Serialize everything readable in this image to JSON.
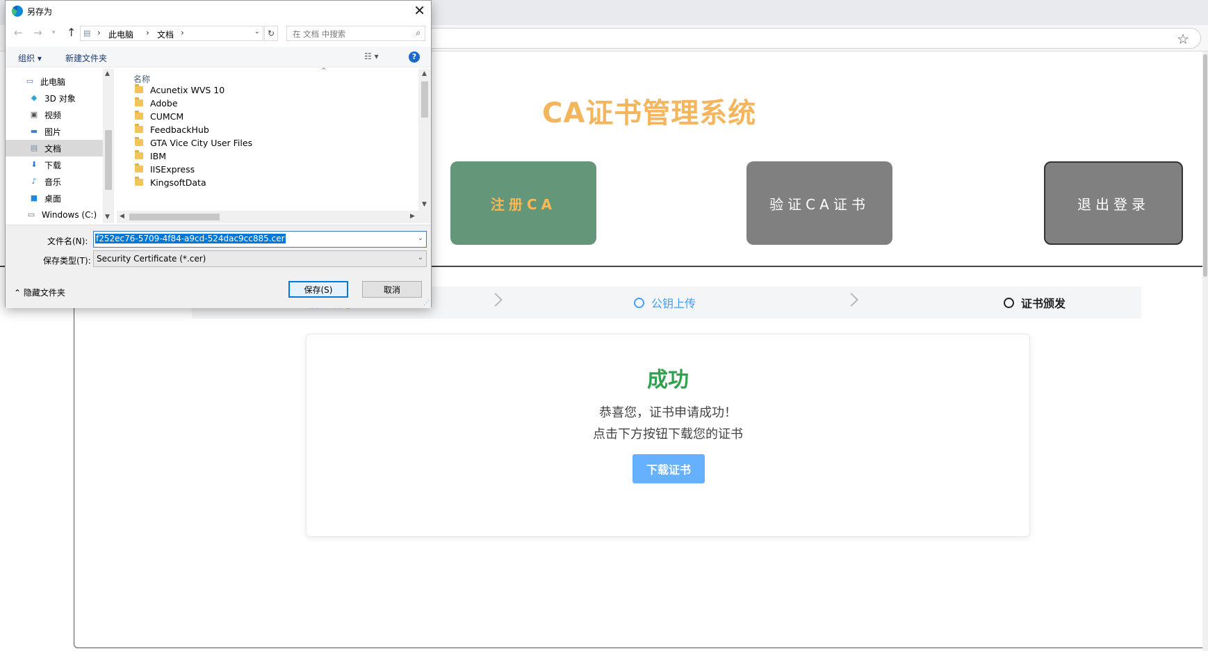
{
  "page": {
    "title": "CA证书管理系统",
    "nav_buttons": {
      "register": "注册CA",
      "verify": "验证CA证书",
      "logout": "退出登录"
    },
    "steps": [
      {
        "label": "CSR信息填写"
      },
      {
        "label": "公钥上传"
      },
      {
        "label": "证书颁发"
      }
    ],
    "result": {
      "title": "成功",
      "line1": "恭喜您，证书申请成功！",
      "line2": "点击下方按钮下载您的证书",
      "download_label": "下载证书"
    },
    "colors": {
      "title": "#f5b55c",
      "register_bg": "#64967a",
      "gray_btn": "#808080",
      "success": "#30a14e",
      "primary": "#409eff"
    }
  },
  "dialog": {
    "title": "另存为",
    "icons": {
      "app": "edge-icon",
      "close": "close-icon"
    },
    "breadcrumb": [
      "此电脑",
      "文档"
    ],
    "search_placeholder": "在 文档 中搜索",
    "toolbar": {
      "organize": "组织 ▾",
      "new_folder": "新建文件夹"
    },
    "nav_items": [
      "此电脑",
      "3D 对象",
      "视频",
      "图片",
      "文档",
      "下载",
      "音乐",
      "桌面",
      "Windows (C:)"
    ],
    "column_header": "名称",
    "files": [
      "Acunetix WVS 10",
      "Adobe",
      "CUMCM",
      "FeedbackHub",
      "GTA Vice City User Files",
      "IBM",
      "IISExpress",
      "KingsoftData"
    ],
    "filename_label": "文件名(N):",
    "filename_value": "f252ec76-5709-4f84-a9cd-524dac9cc885.cer",
    "filetype_label": "保存类型(T):",
    "filetype_value": "Security Certificate (*.cer)",
    "hide_folders": "隐藏文件夹",
    "save_label": "保存(S)",
    "cancel_label": "取消"
  }
}
